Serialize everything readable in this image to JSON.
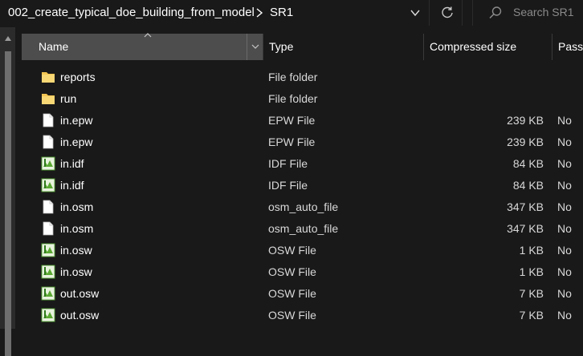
{
  "breadcrumb": {
    "folder": "002_create_typical_doe_building_from_model",
    "subfolder": "SR1"
  },
  "search": {
    "placeholder": "Search SR1"
  },
  "columns": {
    "name": "Name",
    "type": "Type",
    "compressed_size": "Compressed size",
    "password": "Passw"
  },
  "files": [
    {
      "name": "reports",
      "type": "File folder",
      "size": "",
      "password": "",
      "icon": "folder-icon"
    },
    {
      "name": "run",
      "type": "File folder",
      "size": "",
      "password": "",
      "icon": "folder-icon"
    },
    {
      "name": "in.epw",
      "type": "EPW File",
      "size": "239 KB",
      "password": "No",
      "icon": "blank-file-icon"
    },
    {
      "name": "in.epw",
      "type": "EPW File",
      "size": "239 KB",
      "password": "No",
      "icon": "blank-file-icon"
    },
    {
      "name": "in.idf",
      "type": "IDF File",
      "size": "84 KB",
      "password": "No",
      "icon": "idf-file-icon"
    },
    {
      "name": "in.idf",
      "type": "IDF File",
      "size": "84 KB",
      "password": "No",
      "icon": "idf-file-icon"
    },
    {
      "name": "in.osm",
      "type": "osm_auto_file",
      "size": "347 KB",
      "password": "No",
      "icon": "blank-file-icon"
    },
    {
      "name": "in.osm",
      "type": "osm_auto_file",
      "size": "347 KB",
      "password": "No",
      "icon": "blank-file-icon"
    },
    {
      "name": "in.osw",
      "type": "OSW File",
      "size": "1 KB",
      "password": "No",
      "icon": "osw-file-icon"
    },
    {
      "name": "in.osw",
      "type": "OSW File",
      "size": "1 KB",
      "password": "No",
      "icon": "osw-file-icon"
    },
    {
      "name": "out.osw",
      "type": "OSW File",
      "size": "7 KB",
      "password": "No",
      "icon": "osw-file-icon"
    },
    {
      "name": "out.osw",
      "type": "OSW File",
      "size": "7 KB",
      "password": "No",
      "icon": "osw-file-icon"
    }
  ],
  "colors": {
    "background": "#191919",
    "header_selected": "#4d4d4d",
    "folder": "#f3c552",
    "text": "#ffffff",
    "muted": "#8a8a8a"
  }
}
